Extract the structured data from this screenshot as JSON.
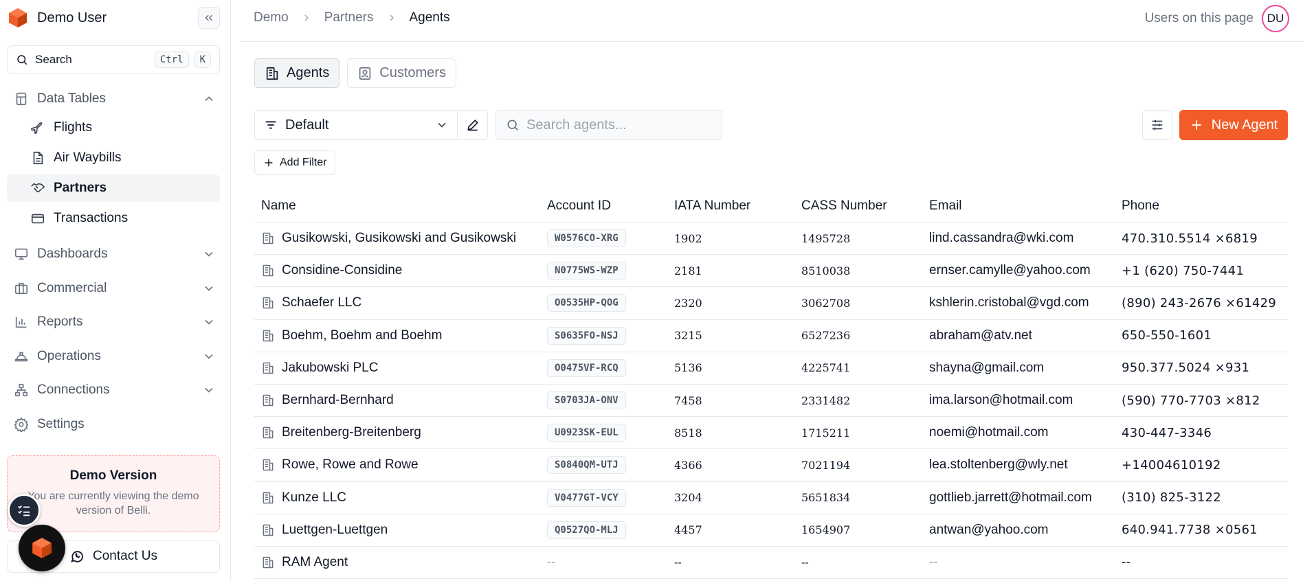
{
  "sidebar": {
    "brand": "Demo User",
    "search_label": "Search",
    "shortcut": [
      "Ctrl",
      "K"
    ],
    "data_tables": {
      "label": "Data Tables",
      "items": [
        {
          "label": "Flights",
          "icon": "plane-icon",
          "active": false
        },
        {
          "label": "Air Waybills",
          "icon": "document-icon",
          "active": false
        },
        {
          "label": "Partners",
          "icon": "handshake-icon",
          "active": true
        },
        {
          "label": "Transactions",
          "icon": "credit-card-icon",
          "active": false
        }
      ]
    },
    "sections": [
      {
        "label": "Dashboards",
        "icon": "monitor-icon"
      },
      {
        "label": "Commercial",
        "icon": "briefcase-icon"
      },
      {
        "label": "Reports",
        "icon": "bar-chart-icon"
      },
      {
        "label": "Operations",
        "icon": "hard-hat-icon"
      },
      {
        "label": "Connections",
        "icon": "network-icon"
      }
    ],
    "settings_label": "Settings",
    "demo": {
      "title": "Demo Version",
      "text": "You are currently viewing the demo version of Belli."
    },
    "contact_label": "Contact Us"
  },
  "header": {
    "breadcrumb": [
      "Demo",
      "Partners",
      "Agents"
    ],
    "users_label": "Users on this page",
    "avatar_initials": "DU"
  },
  "tabs": [
    {
      "label": "Agents",
      "active": true
    },
    {
      "label": "Customers",
      "active": false
    }
  ],
  "toolbar": {
    "view_value": "Default",
    "search_placeholder": "Search agents...",
    "new_label": "New Agent",
    "add_filter_label": "Add Filter"
  },
  "colors": {
    "accent": "#f25c28",
    "avatar_ring": "#ec4899"
  },
  "table": {
    "columns": [
      "Name",
      "Account ID",
      "IATA Number",
      "CASS Number",
      "Email",
      "Phone"
    ],
    "rows": [
      [
        "Gusikowski, Gusikowski and Gusikowski",
        "W0576CO-XRG",
        "1902",
        "1495728",
        "lind.cassandra@wki.com",
        "470.310.5514 ×6819"
      ],
      [
        "Considine-Considine",
        "N0775WS-WZP",
        "2181",
        "8510038",
        "ernser.camylle@yahoo.com",
        "+1 (620) 750-7441"
      ],
      [
        "Schaefer LLC",
        "O0535HP-QOG",
        "2320",
        "3062708",
        "kshlerin.cristobal@vgd.com",
        "(890) 243-2676 ×61429"
      ],
      [
        "Boehm, Boehm and Boehm",
        "S0635FO-NSJ",
        "3215",
        "6527236",
        "abraham@atv.net",
        "650-550-1601"
      ],
      [
        "Jakubowski PLC",
        "O0475VF-RCQ",
        "5136",
        "4225741",
        "shayna@gmail.com",
        "950.377.5024 ×931"
      ],
      [
        "Bernhard-Bernhard",
        "S0703JA-ONV",
        "7458",
        "2331482",
        "ima.larson@hotmail.com",
        "(590) 770-7703 ×812"
      ],
      [
        "Breitenberg-Breitenberg",
        "U0923SK-EUL",
        "8518",
        "1715211",
        "noemi@hotmail.com",
        "430-447-3346"
      ],
      [
        "Rowe, Rowe and Rowe",
        "S0840QM-UTJ",
        "4366",
        "7021194",
        "lea.stoltenberg@wly.net",
        "+14004610192"
      ],
      [
        "Kunze LLC",
        "V0477GT-VCY",
        "3204",
        "5651834",
        "gottlieb.jarrett@hotmail.com",
        "(310) 825-3122"
      ],
      [
        "Luettgen-Luettgen",
        "Q0527QO-MLJ",
        "4457",
        "1654907",
        "antwan@yahoo.com",
        "640.941.7738 ×0561"
      ],
      [
        "RAM Agent",
        "--",
        "--",
        "--",
        "--",
        "--"
      ]
    ]
  }
}
